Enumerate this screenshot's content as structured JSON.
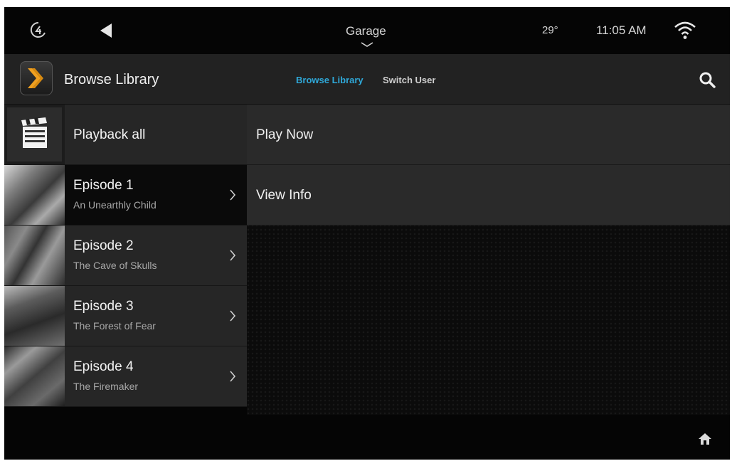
{
  "status_bar": {
    "room": "Garage",
    "temperature": "29°",
    "time": "11:05 AM",
    "icons": [
      "brand-c4-icon",
      "back-arrow-icon",
      "chevron-down-icon",
      "wifi-icon"
    ]
  },
  "header": {
    "title": "Browse Library",
    "tabs": [
      {
        "label": "Browse Library",
        "active": true
      },
      {
        "label": "Switch User",
        "active": false
      }
    ],
    "search_icon": "search-icon"
  },
  "list": {
    "items": [
      {
        "title": "Playback all",
        "subtitle": "",
        "icon": "clapperboard-icon"
      },
      {
        "title": "Episode 1",
        "subtitle": "An Unearthly Child",
        "selected": true
      },
      {
        "title": "Episode 2",
        "subtitle": "The Cave of Skulls"
      },
      {
        "title": "Episode 3",
        "subtitle": "The Forest of Fear"
      },
      {
        "title": "Episode 4",
        "subtitle": "The Firemaker"
      }
    ]
  },
  "actions": [
    {
      "label": "Play Now"
    },
    {
      "label": "View Info"
    }
  ],
  "footer": {
    "icon": "home-room-icon"
  },
  "colors": {
    "accent": "#2fa8d8",
    "background": "#050505",
    "row": "#262626",
    "selected_row": "#0a0a0a"
  }
}
